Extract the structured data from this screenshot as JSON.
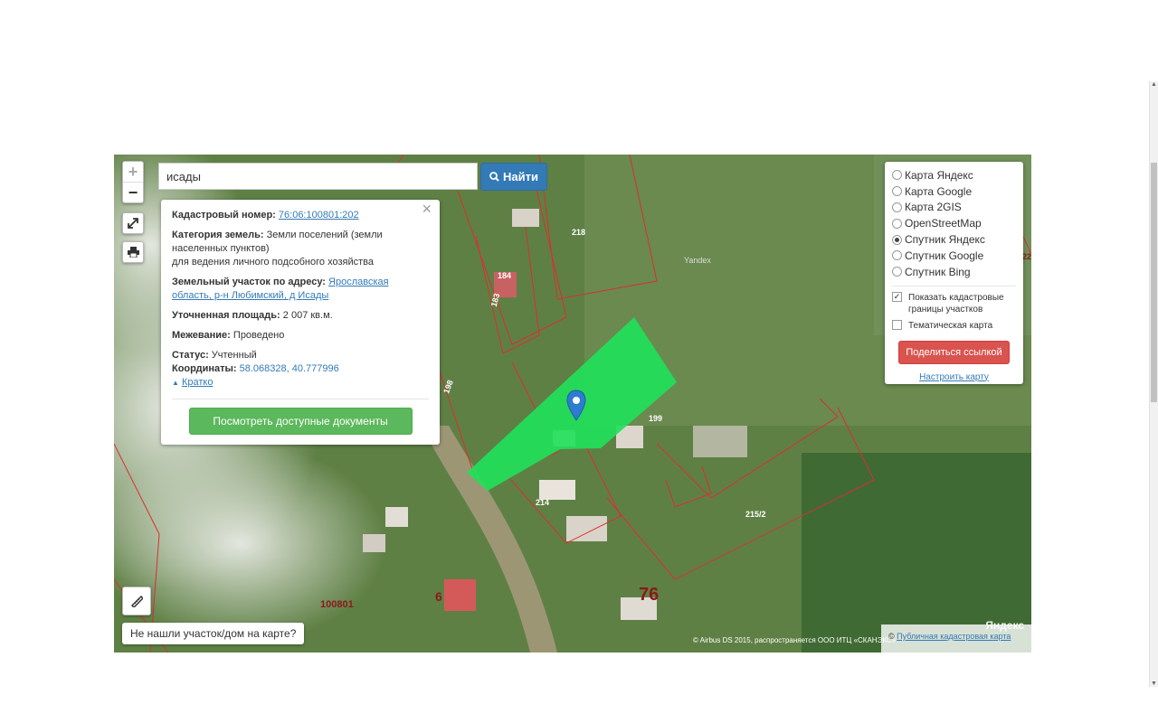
{
  "search": {
    "value": "исады",
    "button_label": "Найти"
  },
  "zoom": {
    "in": "+",
    "out": "−"
  },
  "info": {
    "cadastral_label": "Кадастровый номер:",
    "cadastral_value": "76:06:100801:202",
    "category_label": "Категория земель:",
    "category_value": "Земли поселений (земли населенных пунктов)",
    "category_use": "для ведения личного подсобного хозяйства",
    "address_label": "Земельный участок по адресу:",
    "address_value": "Ярославская область, р-н Любимский, д Исады",
    "area_label": "Уточненная площадь:",
    "area_value": "2 007 кв.м.",
    "survey_label": "Межевание:",
    "survey_value": "Проведено",
    "status_label": "Статус:",
    "status_value": "Учтенный",
    "coords_label": "Координаты:",
    "coords_value": "58.068328, 40.777996",
    "brief_label": "Кратко",
    "docs_button": "Посмотреть доступные документы",
    "close": "×"
  },
  "layers": {
    "options": [
      {
        "label": "Карта Яндекс",
        "selected": false
      },
      {
        "label": "Карта Google",
        "selected": false
      },
      {
        "label": "Карта 2GIS",
        "selected": false
      },
      {
        "label": "OpenStreetMap",
        "selected": false
      },
      {
        "label": "Спутник Яндекс",
        "selected": true
      },
      {
        "label": "Спутник Google",
        "selected": false
      },
      {
        "label": "Спутник Bing",
        "selected": false
      }
    ],
    "show_boundaries": "Показать кадастровые границы участков",
    "thematic": "Тематическая карта",
    "share_button": "Поделиться ссылкой",
    "settings_link": "Настроить карту"
  },
  "not_found_button": "Не нашли участок/дом на карте?",
  "attribution_left": "© Airbus DS 2015, распространяется ООО ИТЦ «СКАНЭКС»",
  "attribution_right_prefix": "©",
  "attribution_right_link": "Публичная кадастровая карта",
  "yandex_logo": "Яндекс",
  "yandex_label": "Yandex",
  "parcel_labels": {
    "p218": "218",
    "p184": "184",
    "p183": "183",
    "p198": "198",
    "p199": "199",
    "p214": "214",
    "p215_2": "215/2",
    "p100801": "100801",
    "p76": "76",
    "p6": "6",
    "p22": "22"
  },
  "colors": {
    "parcel": "#22e05a",
    "boundary": "#d93030",
    "search_button": "#337ab7",
    "docs_button": "#5cb85c",
    "share_button": "#d9534f"
  }
}
